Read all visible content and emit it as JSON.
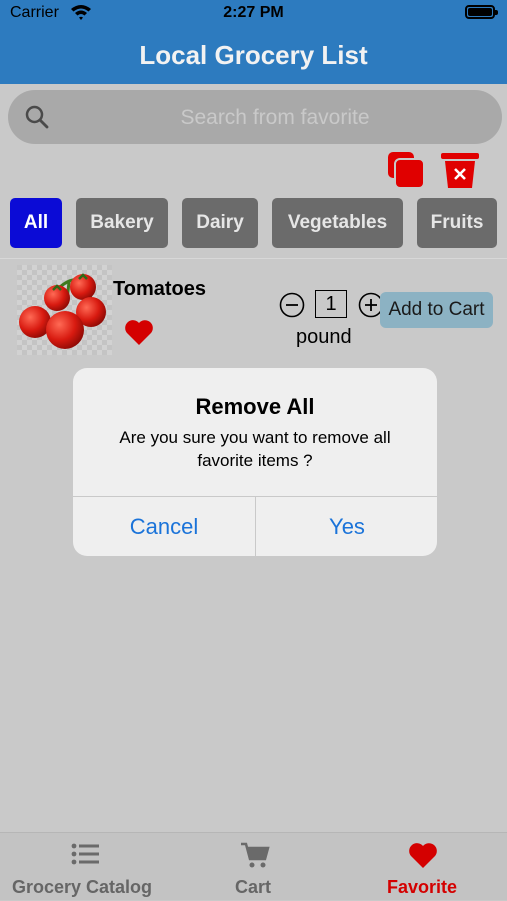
{
  "status_bar": {
    "carrier": "Carrier",
    "time": "2:27 PM"
  },
  "nav": {
    "title": "Local Grocery List"
  },
  "search": {
    "placeholder": "Search from favorite"
  },
  "toolbar": {
    "copy_icon": "copy-icon",
    "remove_all_icon": "remove-all-icon"
  },
  "tabs": [
    {
      "label": "All",
      "active": true
    },
    {
      "label": "Bakery",
      "active": false
    },
    {
      "label": "Dairy",
      "active": false
    },
    {
      "label": "Vegetables",
      "active": false
    },
    {
      "label": "Fruits",
      "active": false
    }
  ],
  "items": [
    {
      "name": "Tomatoes",
      "quantity": "1",
      "unit": "pound",
      "add_label": "Add to Cart",
      "favorite": true
    }
  ],
  "dialog": {
    "title": "Remove All",
    "message": "Are you sure you want to remove all favorite items ?",
    "cancel": "Cancel",
    "confirm": "Yes"
  },
  "tab_bar": [
    {
      "label": "Grocery Catalog",
      "icon": "list-icon",
      "active": false
    },
    {
      "label": "Cart",
      "icon": "cart-icon",
      "active": false
    },
    {
      "label": "Favorite",
      "icon": "heart-icon",
      "active": true
    }
  ],
  "colors": {
    "header": "#2d7bbf",
    "active_tab": "#0b0bd6",
    "tab": "#6b6b6b",
    "favorite": "#d40000",
    "dialog_button": "#1a73d9",
    "add_to_cart": "#8cb2c3"
  }
}
